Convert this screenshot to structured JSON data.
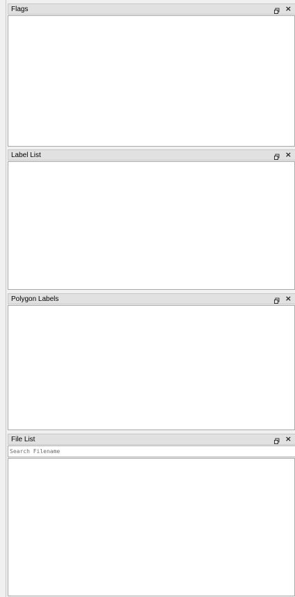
{
  "docks": {
    "flags": {
      "title": "Flags"
    },
    "label_list": {
      "title": "Label List"
    },
    "polygon_labels": {
      "title": "Polygon Labels"
    },
    "file_list": {
      "title": "File List",
      "search_placeholder": "Search Filename"
    }
  },
  "icons": {
    "float": "float-icon",
    "close": "close-icon"
  },
  "close_glyph": "×"
}
